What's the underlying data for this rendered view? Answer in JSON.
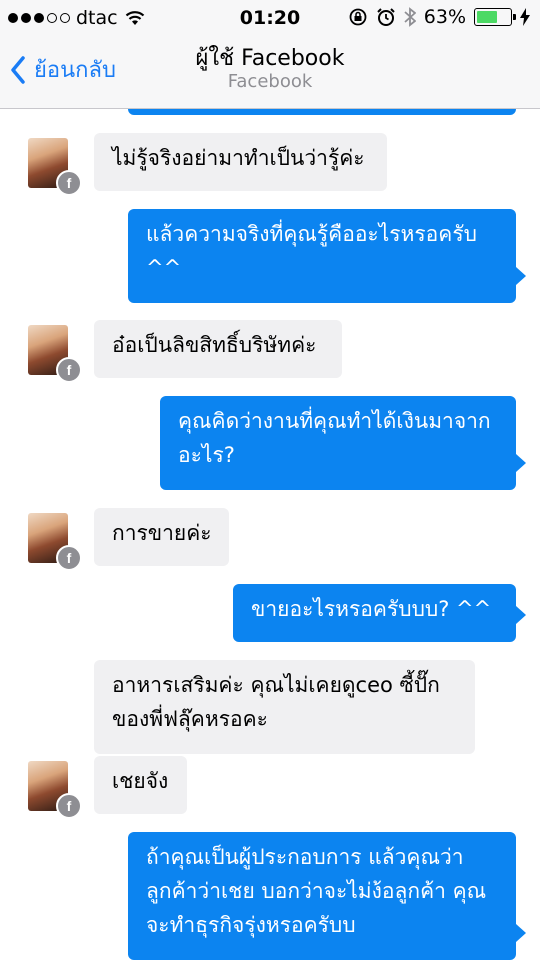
{
  "status": {
    "carrier": "dtac",
    "time": "01:20",
    "battery": "63%",
    "battery_level": 0.63,
    "signal_bars_filled": 3,
    "signal_bars_total": 5
  },
  "nav": {
    "back_label": "ย้อนกลับ",
    "title": "ผู้ใช้ Facebook",
    "subtitle": "Facebook"
  },
  "messages": [
    {
      "from": "them",
      "lines": [
        "ไม่รู้จริงอย่ามาทำเป็นว่ารู้ค่ะ"
      ]
    },
    {
      "from": "me",
      "lines": [
        "แล้วความจริงที่คุณรู้คืออะไรหรอครับ",
        "^^"
      ]
    },
    {
      "from": "them",
      "lines": [
        "อ๋อเป็นลิขสิทธิ์บริษัทค่ะ"
      ]
    },
    {
      "from": "me",
      "lines": [
        "คุณคิดว่างานที่คุณทำได้เงินมาจาก",
        "อะไร?"
      ]
    },
    {
      "from": "them",
      "lines": [
        "การขายค่ะ"
      ]
    },
    {
      "from": "me",
      "lines": [
        "ขายอะไรหรอครับบบ? ^^"
      ]
    },
    {
      "from": "them",
      "lines": [
        "อาหารเสริมค่ะ คุณไม่เคยดูceo ซี้ปั๊ก",
        "ของพี่ฟลุ๊คหรอคะ"
      ]
    },
    {
      "from": "them",
      "lines": [
        "เชยจัง"
      ]
    },
    {
      "from": "me",
      "lines": [
        "ถ้าคุณเป็นผู้ประกอบการ แล้วคุณว่า",
        "ลูกค้าว่าเชย บอกว่าจะไม่ง้อลูกค้า คุณ",
        "จะทำธุรกิจรุ่งหรอครับบ"
      ]
    }
  ],
  "avatar_badge": "f",
  "colors": {
    "outgoing_bubble": "#0c84f0",
    "incoming_bubble": "#f0f0f2",
    "accent": "#1a7cf5",
    "battery_fill": "#4cd964"
  }
}
